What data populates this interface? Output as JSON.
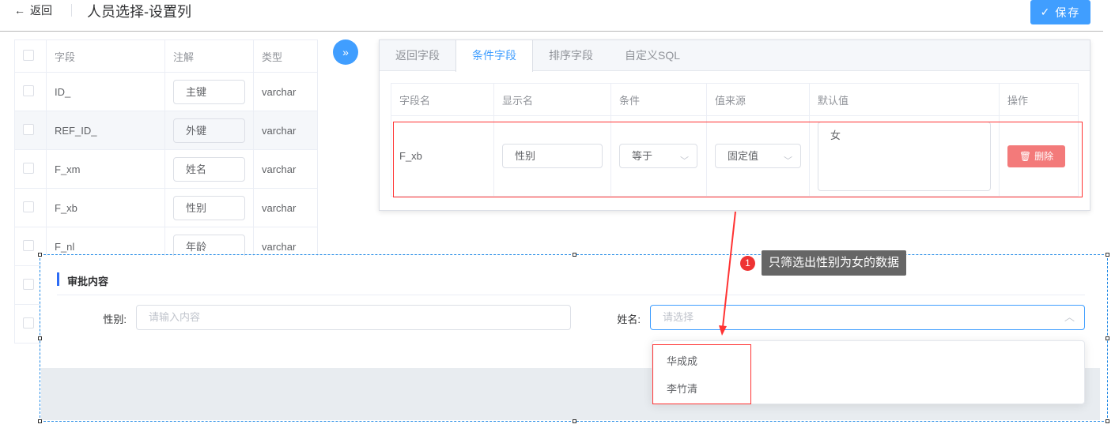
{
  "header": {
    "back_label": "返回",
    "title": "人员选择-设置列",
    "save_label": "保存"
  },
  "left_table": {
    "headers": [
      "字段",
      "注解",
      "类型"
    ],
    "rows": [
      {
        "field": "ID_",
        "comment": "主键",
        "type": "varchar"
      },
      {
        "field": "REF_ID_",
        "comment": "外键",
        "type": "varchar"
      },
      {
        "field": "F_xm",
        "comment": "姓名",
        "type": "varchar"
      },
      {
        "field": "F_xb",
        "comment": "性别",
        "type": "varchar"
      },
      {
        "field": "F_nl",
        "comment": "年龄",
        "type": "varchar"
      }
    ]
  },
  "tabs": [
    "返回字段",
    "条件字段",
    "排序字段",
    "自定义SQL"
  ],
  "cond_table": {
    "headers": [
      "字段名",
      "显示名",
      "条件",
      "值来源",
      "默认值",
      "操作"
    ],
    "row": {
      "field": "F_xb",
      "display": "性别",
      "condition": "等于",
      "source": "固定值",
      "default": "女",
      "delete_label": "删除"
    }
  },
  "annotation": {
    "badge": "1",
    "text": "只筛选出性别为女的数据"
  },
  "form": {
    "section_title": "审批内容",
    "gender_label": "性别:",
    "gender_placeholder": "请输入内容",
    "name_label": "姓名:",
    "name_placeholder": "请选择",
    "options": [
      "华成成",
      "李竹清"
    ]
  },
  "colors": {
    "primary": "#409eff",
    "danger": "#f37a7a",
    "annotation_red": "#ff3333"
  }
}
